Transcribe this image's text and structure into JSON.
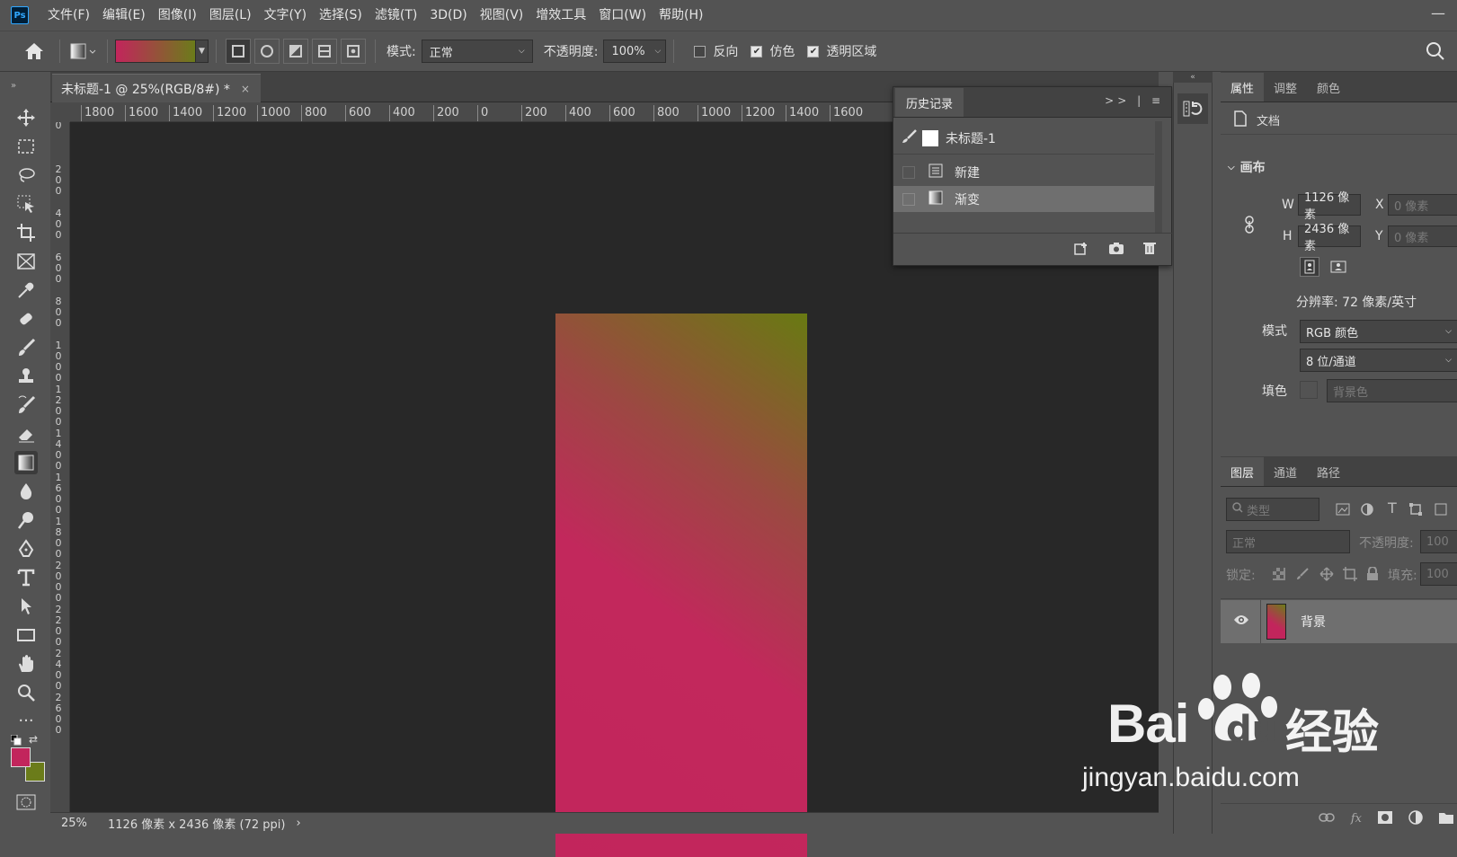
{
  "menubar": {
    "logo": "Ps",
    "items": [
      "文件(F)",
      "编辑(E)",
      "图像(I)",
      "图层(L)",
      "文字(Y)",
      "选择(S)",
      "滤镜(T)",
      "3D(D)",
      "视图(V)",
      "增效工具",
      "窗口(W)",
      "帮助(H)"
    ],
    "minimize": "—"
  },
  "options": {
    "mode_label": "模式:",
    "mode_value": "正常",
    "opacity_label": "不透明度:",
    "opacity_value": "100%",
    "reverse_label": "反向",
    "dither_label": "仿色",
    "transparency_label": "透明区域",
    "reverse_checked": false,
    "dither_checked": true,
    "transparency_checked": true,
    "gradient_colors": [
      "#c2255c",
      "#6b7c1a"
    ]
  },
  "document": {
    "tab_title": "未标题-1 @ 25%(RGB/8#) *",
    "close": "×"
  },
  "ruler_h": [
    "1800",
    "1600",
    "1400",
    "1200",
    "1000",
    "800",
    "600",
    "400",
    "200",
    "0",
    "200",
    "400",
    "600",
    "800",
    "1000",
    "1200",
    "1400",
    "1600"
  ],
  "ruler_v": [
    "0",
    "2 0 0",
    "4 0 0",
    "6 0 0",
    "8 0 0",
    "1 0 0 0",
    "1 2 0 0",
    "1 4 0 0",
    "1 6 0 0",
    "1 8 0 0",
    "2 0 0 0",
    "2 2 0 0",
    "2 4 0 0",
    "2 6 0 0"
  ],
  "status": {
    "zoom": "25%",
    "info": "1126 像素 x 2436 像素 (72 ppi)",
    "arrow": "›"
  },
  "history": {
    "tab": "历史记录",
    "snapshot": "未标题-1",
    "items": [
      {
        "label": "新建",
        "selected": false
      },
      {
        "label": "渐变",
        "selected": true
      }
    ],
    "controls": ">> |"
  },
  "properties": {
    "tabs": [
      "属性",
      "调整",
      "颜色"
    ],
    "doc_label": "文档",
    "section": "画布",
    "w_label": "W",
    "w_value": "1126 像素",
    "h_label": "H",
    "h_value": "2436 像素",
    "x_label": "X",
    "x_value": "0 像素",
    "y_label": "Y",
    "y_value": "0 像素",
    "resolution": "分辨率: 72 像素/英寸",
    "mode_label": "模式",
    "mode_value": "RGB 颜色",
    "depth_value": "8 位/通道",
    "fill_label": "填色",
    "fill_value": "背景色"
  },
  "layers": {
    "tabs": [
      "图层",
      "通道",
      "路径"
    ],
    "filter_placeholder": "类型",
    "blend": "正常",
    "opacity_label": "不透明度:",
    "opacity_value": "100",
    "lock_label": "锁定:",
    "fill_label": "填充:",
    "fill_value": "100",
    "layer_name": "背景"
  },
  "watermark": {
    "brand": "Bai",
    "brand2": "du",
    "cn": "经验",
    "url": "jingyan.baidu.com"
  },
  "colors": {
    "foreground": "#c2255c",
    "background": "#6b7c1a",
    "accent": "#31a8ff"
  }
}
